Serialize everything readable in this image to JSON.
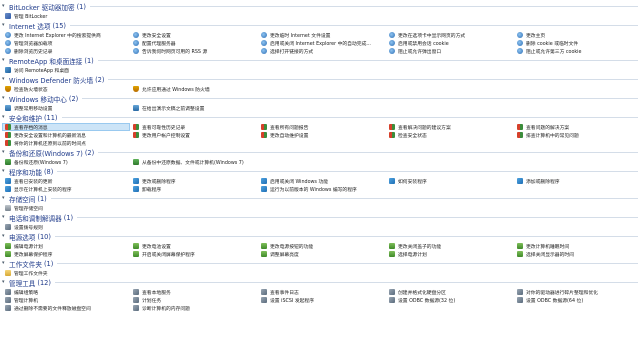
{
  "groups": [
    {
      "title": "BitLocker 驱动器加密",
      "count": "(1)",
      "cols": 1,
      "items": [
        {
          "label": "管理 BitLocker",
          "icon": "sec"
        }
      ]
    },
    {
      "title": "Internet 选项",
      "count": "(15)",
      "cols": 5,
      "items": [
        {
          "label": "更改 Internet Explorer 中的搜索提供商",
          "icon": "net"
        },
        {
          "label": "更改安全设置",
          "icon": "net"
        },
        {
          "label": "更改临时 Internet 文件设置",
          "icon": "net"
        },
        {
          "label": "更改在选项卡中显示网页的方式",
          "icon": "net"
        },
        {
          "label": "更改主页",
          "icon": "net"
        },
        {
          "label": "管理浏览器加载项",
          "icon": "net"
        },
        {
          "label": "配置代理服务器",
          "icon": "net"
        },
        {
          "label": "启用或关闭 Internet Explorer 中的自动完成...",
          "icon": "net"
        },
        {
          "label": "启用或禁用会话 cookie",
          "icon": "net"
        },
        {
          "label": "删除 cookie 或临时文件",
          "icon": "net"
        },
        {
          "label": "删除浏览历史记录",
          "icon": "net"
        },
        {
          "label": "告诉我何时网页可用的 RSS 源",
          "icon": "net"
        },
        {
          "label": "选择打开链接的方式",
          "icon": "net"
        },
        {
          "label": "阻止或允许弹出窗口",
          "icon": "net"
        },
        {
          "label": "阻止或允许第三方 cookie",
          "icon": "net"
        }
      ]
    },
    {
      "title": "RemoteApp 和桌面连接",
      "count": "(1)",
      "cols": 1,
      "items": [
        {
          "label": "访问 RemoteApp 和桌面",
          "icon": "remote"
        }
      ]
    },
    {
      "title": "Windows Defender 防火墙",
      "count": "(2)",
      "cols": 5,
      "items": [
        {
          "label": "检查防火墙状态",
          "icon": "shield"
        },
        {
          "label": "允许应用通过 Windows 防火墙",
          "icon": "shield"
        }
      ]
    },
    {
      "title": "Windows 移动中心",
      "count": "(2)",
      "cols": 5,
      "items": [
        {
          "label": "调整常用移动设置",
          "icon": "mobile"
        },
        {
          "label": "在给出演示文稿之前调整设置",
          "icon": "mobile"
        }
      ]
    },
    {
      "title": "安全和维护",
      "count": "(11)",
      "cols": 5,
      "items": [
        {
          "label": "查看存档的消息",
          "icon": "flag",
          "highlight": true
        },
        {
          "label": "查看可靠性历史记录",
          "icon": "flag"
        },
        {
          "label": "查看所有问题报告",
          "icon": "flag"
        },
        {
          "label": "查看解决问题的建议方案",
          "icon": "flag"
        },
        {
          "label": "查看问题的解决方案",
          "icon": "flag"
        },
        {
          "label": "更改安全设置和计算机的最新消息",
          "icon": "flag"
        },
        {
          "label": "更改用户帐户控制设置",
          "icon": "flag"
        },
        {
          "label": "更改自动维护设置",
          "icon": "flag"
        },
        {
          "label": "检查安全状态",
          "icon": "flag"
        },
        {
          "label": "排查计算机中的常见问题",
          "icon": "flag"
        },
        {
          "label": "将你的计算机还原到以前的时间点",
          "icon": "flag"
        }
      ]
    },
    {
      "title": "备份和还原(Windows 7)",
      "count": "(2)",
      "cols": 5,
      "items": [
        {
          "label": "备份和还原(Windows 7)",
          "icon": "backup"
        },
        {
          "label": "从备份中还原数据、文件或计算机(Windows 7)",
          "icon": "backup"
        }
      ]
    },
    {
      "title": "程序和功能",
      "count": "(8)",
      "cols": 5,
      "items": [
        {
          "label": "查看已安装的更新",
          "icon": "win"
        },
        {
          "label": "更改或删除程序",
          "icon": "win"
        },
        {
          "label": "启用或关闭 Windows 功能",
          "icon": "win"
        },
        {
          "label": "如何安装程序",
          "icon": "win"
        },
        {
          "label": "添加或删除程序",
          "icon": "win"
        },
        {
          "label": "显示在计算机上安装的程序",
          "icon": "win"
        },
        {
          "label": "卸载程序",
          "icon": "win"
        },
        {
          "label": "运行为以前版本的 Windows 编写的程序",
          "icon": "win"
        }
      ]
    },
    {
      "title": "存储空间",
      "count": "(1)",
      "cols": 1,
      "items": [
        {
          "label": "管理存储空间",
          "icon": "disk"
        }
      ]
    },
    {
      "title": "电话和调制解调器",
      "count": "(1)",
      "cols": 1,
      "items": [
        {
          "label": "设置拨号规则",
          "icon": "tool"
        }
      ]
    },
    {
      "title": "电源选项",
      "count": "(10)",
      "cols": 5,
      "items": [
        {
          "label": "编辑电源计划",
          "icon": "power"
        },
        {
          "label": "更改电池设置",
          "icon": "power"
        },
        {
          "label": "更改电源按钮的功能",
          "icon": "power"
        },
        {
          "label": "更改关闭盖子的功能",
          "icon": "power"
        },
        {
          "label": "更改计算机睡眠时间",
          "icon": "power"
        },
        {
          "label": "更改屏幕保护程序",
          "icon": "power"
        },
        {
          "label": "开启或关闭屏幕保护程序",
          "icon": "power"
        },
        {
          "label": "调整屏幕亮度",
          "icon": "power"
        },
        {
          "label": "选择电源计划",
          "icon": "power"
        },
        {
          "label": "选择关闭显示器的时间",
          "icon": "power"
        }
      ]
    },
    {
      "title": "工作文件夹",
      "count": "(1)",
      "cols": 1,
      "items": [
        {
          "label": "管理工作文件夹",
          "icon": "folder"
        }
      ]
    },
    {
      "title": "管理工具",
      "count": "(12)",
      "cols": 5,
      "items": [
        {
          "label": "编辑组策略",
          "icon": "tool"
        },
        {
          "label": "查看本地服务",
          "icon": "tool"
        },
        {
          "label": "查看事件日志",
          "icon": "tool"
        },
        {
          "label": "创建并格式化硬盘分区",
          "icon": "tool"
        },
        {
          "label": "对你的驱动器进行碎片整理和优化",
          "icon": "tool"
        },
        {
          "label": "管理计算机",
          "icon": "tool"
        },
        {
          "label": "计划任务",
          "icon": "tool"
        },
        {
          "label": "设置 iSCSI 发起程序",
          "icon": "tool"
        },
        {
          "label": "设置 ODBC 数据源(32 位)",
          "icon": "tool"
        },
        {
          "label": "设置 ODBC 数据源(64 位)",
          "icon": "tool"
        },
        {
          "label": "通过删除不需要的文件释放磁盘空间",
          "icon": "tool"
        },
        {
          "label": "诊断计算机的内存问题",
          "icon": "tool"
        }
      ]
    }
  ]
}
